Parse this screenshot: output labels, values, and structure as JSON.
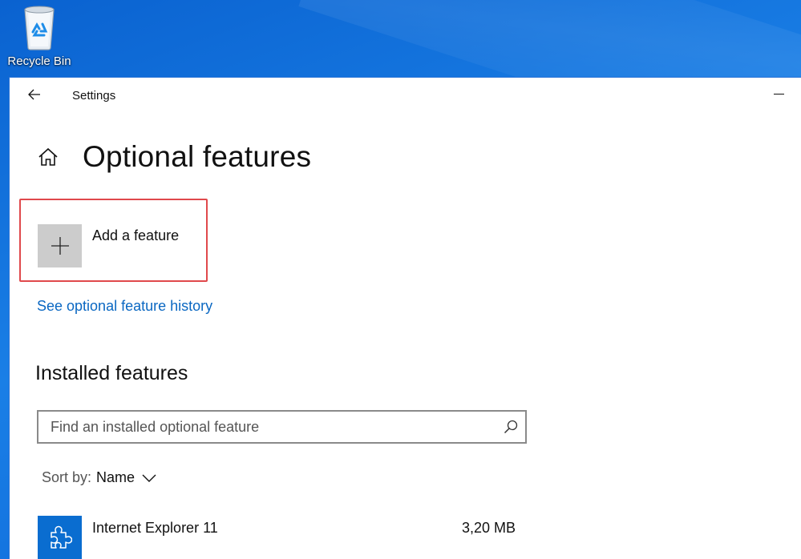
{
  "desktop": {
    "icons": [
      {
        "label": "Recycle Bin",
        "icon": "recycle-bin-icon"
      }
    ]
  },
  "window": {
    "app_title": "Settings",
    "back_icon": "back-arrow-icon",
    "minimize_icon": "minimize-icon"
  },
  "page": {
    "title": "Optional features",
    "home_icon": "home-icon"
  },
  "add_feature": {
    "label": "Add a feature",
    "icon": "plus-icon",
    "highlight_color": "#e0494c"
  },
  "history_link": "See optional feature history",
  "installed": {
    "section_title": "Installed features",
    "search_placeholder": "Find an installed optional feature",
    "search_value": "",
    "sort_prefix": "Sort by:",
    "sort_value": "Name",
    "features": [
      {
        "name": "Internet Explorer 11",
        "size": "3,20 MB",
        "icon": "puzzle-piece-icon"
      }
    ]
  },
  "colors": {
    "accent": "#0a6dd0",
    "link": "#0a67c2",
    "desktop_background": "#1a7fe6"
  }
}
